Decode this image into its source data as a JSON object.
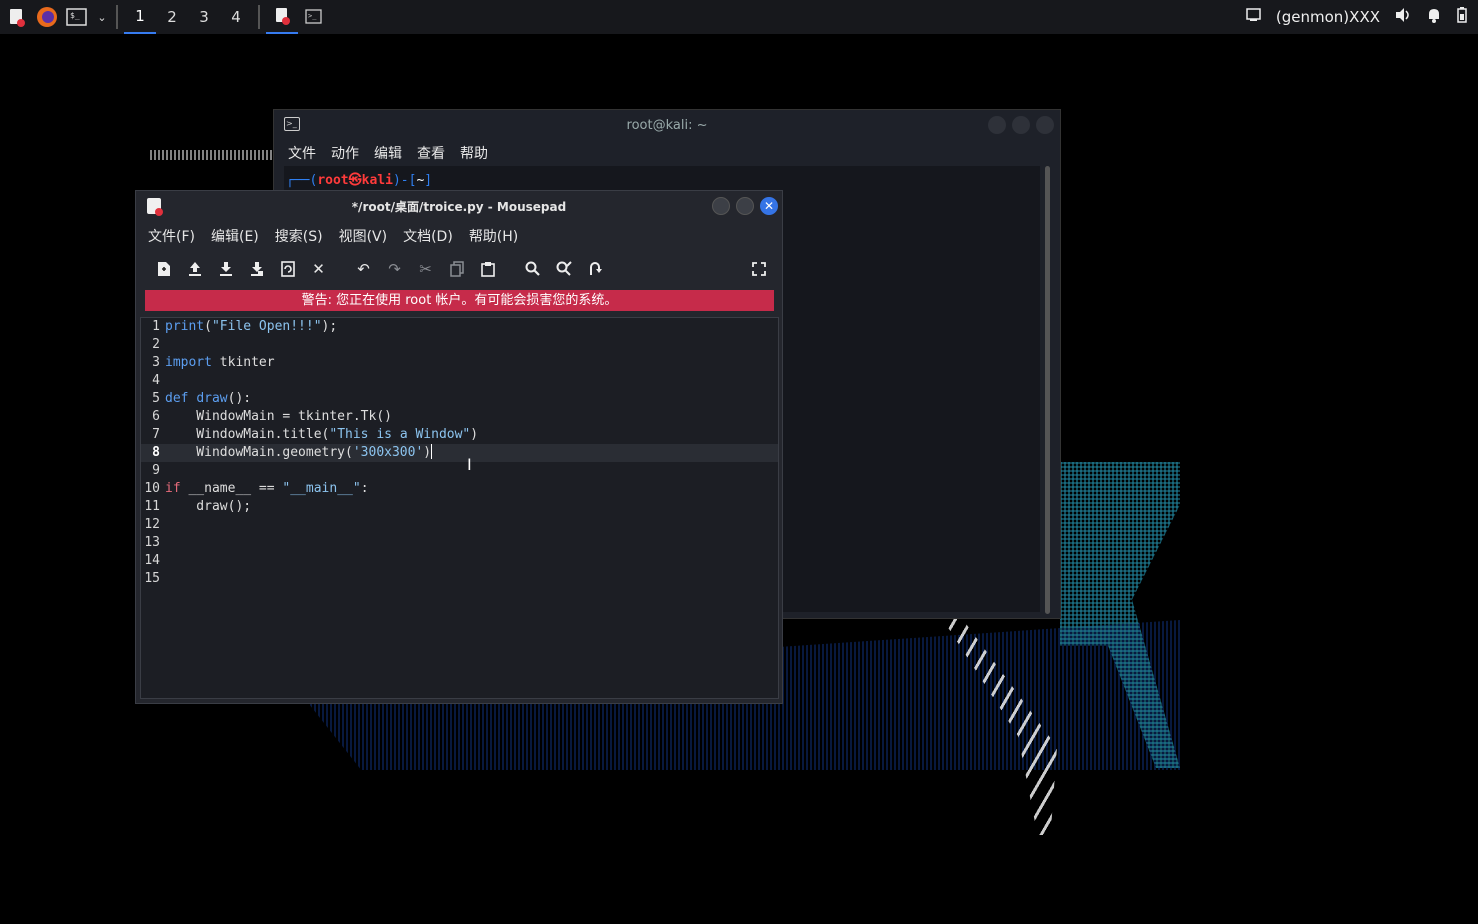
{
  "taskbar": {
    "workspaces": [
      "1",
      "2",
      "3",
      "4"
    ],
    "active_workspace": "1",
    "genmon_label": "(genmon)XXX"
  },
  "terminal": {
    "title": "root@kali: ~",
    "menu": [
      "文件",
      "动作",
      "编辑",
      "查看",
      "帮助"
    ],
    "prompt_user": "root",
    "prompt_symbol": "㉿",
    "prompt_host": "kali",
    "prompt_dir": "~"
  },
  "mousepad": {
    "title": "*/root/桌面/troice.py - Mousepad",
    "menu": [
      "文件(F)",
      "编辑(E)",
      "搜索(S)",
      "视图(V)",
      "文档(D)",
      "帮助(H)"
    ],
    "warning": "警告: 您正在使用 root 帐户。有可能会损害您的系统。",
    "current_line": 8,
    "toolbar_icons": [
      "new-document-icon",
      "open-icon",
      "save-icon",
      "save-as-icon",
      "reload-icon",
      "close-document-icon",
      "undo-icon",
      "redo-icon",
      "cut-icon",
      "copy-icon",
      "paste-icon",
      "search-icon",
      "find-replace-icon",
      "go-to-line-icon",
      "fullscreen-icon"
    ],
    "code": [
      {
        "n": "1",
        "t": "print(\"File Open!!!\");"
      },
      {
        "n": "2",
        "t": ""
      },
      {
        "n": "3",
        "t": "import tkinter"
      },
      {
        "n": "4",
        "t": ""
      },
      {
        "n": "5",
        "t": "def draw():"
      },
      {
        "n": "6",
        "t": "    WindowMain = tkinter.Tk()"
      },
      {
        "n": "7",
        "t": "    WindowMain.title(\"This is a Window\")"
      },
      {
        "n": "8",
        "t": "    WindowMain.geometry('300x300')"
      },
      {
        "n": "9",
        "t": ""
      },
      {
        "n": "10",
        "t": "if __name__ == \"__main__\":"
      },
      {
        "n": "11",
        "t": "    draw();"
      },
      {
        "n": "12",
        "t": ""
      },
      {
        "n": "13",
        "t": ""
      },
      {
        "n": "14",
        "t": ""
      },
      {
        "n": "15",
        "t": ""
      }
    ]
  },
  "colors": {
    "accent": "#3574e6",
    "warning_bg": "#c62b4a",
    "keyword": "#5c9ef0",
    "string": "#8cc4ef"
  }
}
